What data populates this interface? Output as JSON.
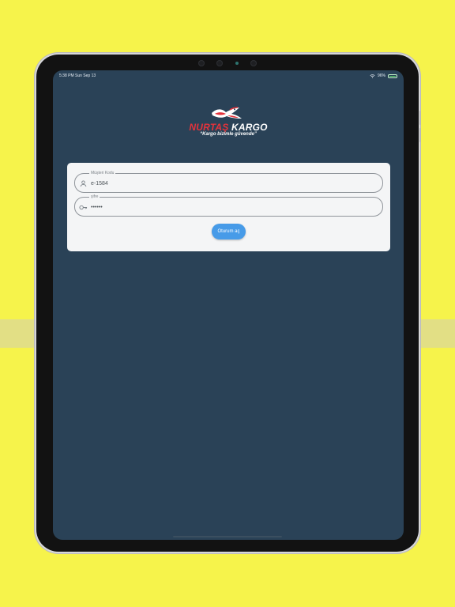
{
  "screen": {
    "status_bar": {
      "time_date": "5:38 PM Sun Sep 13",
      "battery_percent": "96%",
      "battery_level": 0.96
    },
    "logo": {
      "brand_part_1": "NURTAŞ",
      "brand_part_2": "KARGO",
      "tagline": "Kargo bizimle güvende"
    },
    "login_form": {
      "customer_code_label": "Müşteri Kodu",
      "customer_code_value": "e-1584",
      "password_label": "şifre",
      "password_value": "••••••",
      "submit_label": "Oturum aç"
    },
    "icons": {
      "customer_code": "user-icon",
      "password": "key-icon",
      "wifi": "wifi-icon",
      "battery": "battery-icon",
      "logo_mark": "bird-logo-icon"
    }
  }
}
